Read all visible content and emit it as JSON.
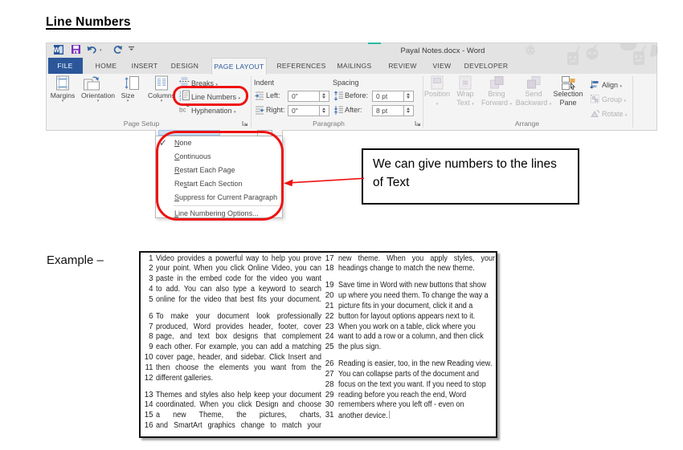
{
  "page": {
    "title": "Line Numbers",
    "example_label": "Example –"
  },
  "window": {
    "title": "Payal Notes.docx - Word",
    "qat_icons": [
      "word-logo",
      "save",
      "undo",
      "redo",
      "customize-quick-access"
    ],
    "tabs": [
      {
        "label": "FILE",
        "active": false,
        "file": true
      },
      {
        "label": "HOME",
        "active": false
      },
      {
        "label": "INSERT",
        "active": false
      },
      {
        "label": "DESIGN",
        "active": false
      },
      {
        "label": "PAGE LAYOUT",
        "active": true
      },
      {
        "label": "REFERENCES",
        "active": false
      },
      {
        "label": "MAILINGS",
        "active": false
      },
      {
        "label": "REVIEW",
        "active": false
      },
      {
        "label": "VIEW",
        "active": false
      },
      {
        "label": "DEVELOPER",
        "active": false
      }
    ],
    "ribbon": {
      "page_setup": {
        "group_label": "Page Setup",
        "big_buttons": [
          {
            "label": "Margins",
            "icon": "margins-icon"
          },
          {
            "label": "Orientation",
            "icon": "orientation-icon"
          },
          {
            "label": "Size",
            "icon": "size-icon"
          },
          {
            "label": "Columns",
            "icon": "columns-icon"
          }
        ],
        "menu_buttons": [
          {
            "label": "Breaks",
            "icon": "breaks-icon"
          },
          {
            "label": "Line Numbers",
            "icon": "line-numbers-icon"
          },
          {
            "label": "Hyphenation",
            "icon": "hyphenation-icon"
          }
        ]
      },
      "paragraph": {
        "group_label": "Paragraph",
        "indent_label": "Indent",
        "spacing_label": "Spacing",
        "fields": [
          {
            "label": "Left:",
            "value": "0\"",
            "icon": "indent-left-icon"
          },
          {
            "label": "Right:",
            "value": "0\"",
            "icon": "indent-right-icon"
          },
          {
            "label": "Before:",
            "value": "0 pt",
            "icon": "spacing-before-icon"
          },
          {
            "label": "After:",
            "value": "8 pt",
            "icon": "spacing-after-icon"
          }
        ]
      },
      "arrange": {
        "group_label": "Arrange",
        "buttons": [
          {
            "lines": [
              "Position",
              ""
            ],
            "disabled": true,
            "icon": "position-icon"
          },
          {
            "lines": [
              "Wrap",
              "Text"
            ],
            "disabled": true,
            "icon": "wrap-text-icon"
          },
          {
            "lines": [
              "Bring",
              "Forward"
            ],
            "disabled": true,
            "icon": "bring-forward-icon"
          },
          {
            "lines": [
              "Send",
              "Backward"
            ],
            "disabled": true,
            "icon": "send-backward-icon"
          },
          {
            "lines": [
              "Selection",
              "Pane"
            ],
            "disabled": false,
            "icon": "selection-pane-icon"
          }
        ],
        "small_buttons": [
          {
            "label": "Align",
            "disabled": false,
            "icon": "align-icon"
          },
          {
            "label": "Group",
            "disabled": true,
            "icon": "group-icon"
          },
          {
            "label": "Rotate",
            "disabled": true,
            "icon": "rotate-icon"
          }
        ]
      }
    }
  },
  "dropdown": {
    "items": [
      {
        "label": "None",
        "accel": 0,
        "checked": true
      },
      {
        "label": "Continuous",
        "accel": 0,
        "checked": false
      },
      {
        "label": "Restart Each Page",
        "accel": 0,
        "checked": false
      },
      {
        "label": "Restart Each Section",
        "accel": 2,
        "checked": false
      },
      {
        "label": "Suppress for Current Paragraph",
        "accel": 0,
        "checked": false
      },
      {
        "label": "Line Numbering Options...",
        "accel": 0,
        "checked": false,
        "separator_before": true
      }
    ]
  },
  "callout": {
    "text": "We can give numbers to the lines of Text"
  },
  "example": {
    "columns": [
      {
        "lines": [
          {
            "n": "1",
            "t": "Video provides a powerful way to help you prove",
            "j": true
          },
          {
            "n": "2",
            "t": "your point. When you click Online Video, you can",
            "j": true
          },
          {
            "n": "3",
            "t": "paste in the embed code for the video you want",
            "j": true
          },
          {
            "n": "4",
            "t": "to add. You can also type a keyword to search",
            "j": true
          },
          {
            "n": "5",
            "t": "online for the video that best fits your document.",
            "j": true
          },
          {
            "n": "6",
            "t": "To make your document look professionally",
            "j": true,
            "p": true
          },
          {
            "n": "7",
            "t": "produced, Word provides header, footer, cover",
            "j": true
          },
          {
            "n": "8",
            "t": "page, and text box designs that complement",
            "j": true
          },
          {
            "n": "9",
            "t": "each other. For example, you can add a matching",
            "j": true
          },
          {
            "n": "10",
            "t": "cover page, header, and sidebar. Click Insert and",
            "j": true
          },
          {
            "n": "11",
            "t": "then choose the elements you want from the",
            "j": true
          },
          {
            "n": "12",
            "t": "different galleries.",
            "j": false
          },
          {
            "n": "13",
            "t": "Themes and styles also help keep your document",
            "j": true,
            "p": true
          },
          {
            "n": "14",
            "t": "coordinated. When you click Design and choose",
            "j": true
          },
          {
            "n": "15",
            "t": "a new Theme, the pictures, charts,",
            "j": true
          },
          {
            "n": "16",
            "t": "and SmartArt graphics change to match your",
            "j": true
          }
        ]
      },
      {
        "lines": [
          {
            "n": "17",
            "t": "new theme. When you apply styles, your",
            "j": true
          },
          {
            "n": "18",
            "t": "headings change to match the new theme.",
            "j": false
          },
          {
            "n": "19",
            "t": "Save time in Word with new buttons that show",
            "j": false,
            "p": true
          },
          {
            "n": "20",
            "t": "up where you need them. To change the way a",
            "j": false
          },
          {
            "n": "21",
            "t": "picture fits in your document, click it and a",
            "j": false
          },
          {
            "n": "22",
            "t": "button for layout options appears next to it.",
            "j": false
          },
          {
            "n": "23",
            "t": "When you work on a table, click where you",
            "j": false
          },
          {
            "n": "24",
            "t": "want to add a row or a column, and then click",
            "j": false
          },
          {
            "n": "25",
            "t": "the plus sign.",
            "j": false
          },
          {
            "n": "26",
            "t": "Reading is easier, too, in the new Reading view.",
            "j": false,
            "p": true
          },
          {
            "n": "27",
            "t": "You can collapse parts of the document and",
            "j": false
          },
          {
            "n": "28",
            "t": "focus on the text you want. If you need to stop",
            "j": false
          },
          {
            "n": "29",
            "t": "reading before you reach the end, Word",
            "j": false
          },
          {
            "n": "30",
            "t": "remembers where you left off - even on",
            "j": false
          },
          {
            "n": "31",
            "t": "another device.",
            "j": false,
            "cursor": true
          }
        ]
      }
    ]
  },
  "colors": {
    "annotation_red": "#ee1111",
    "accent_blue": "#2b579a",
    "save_purple": "#7b2fbe"
  }
}
